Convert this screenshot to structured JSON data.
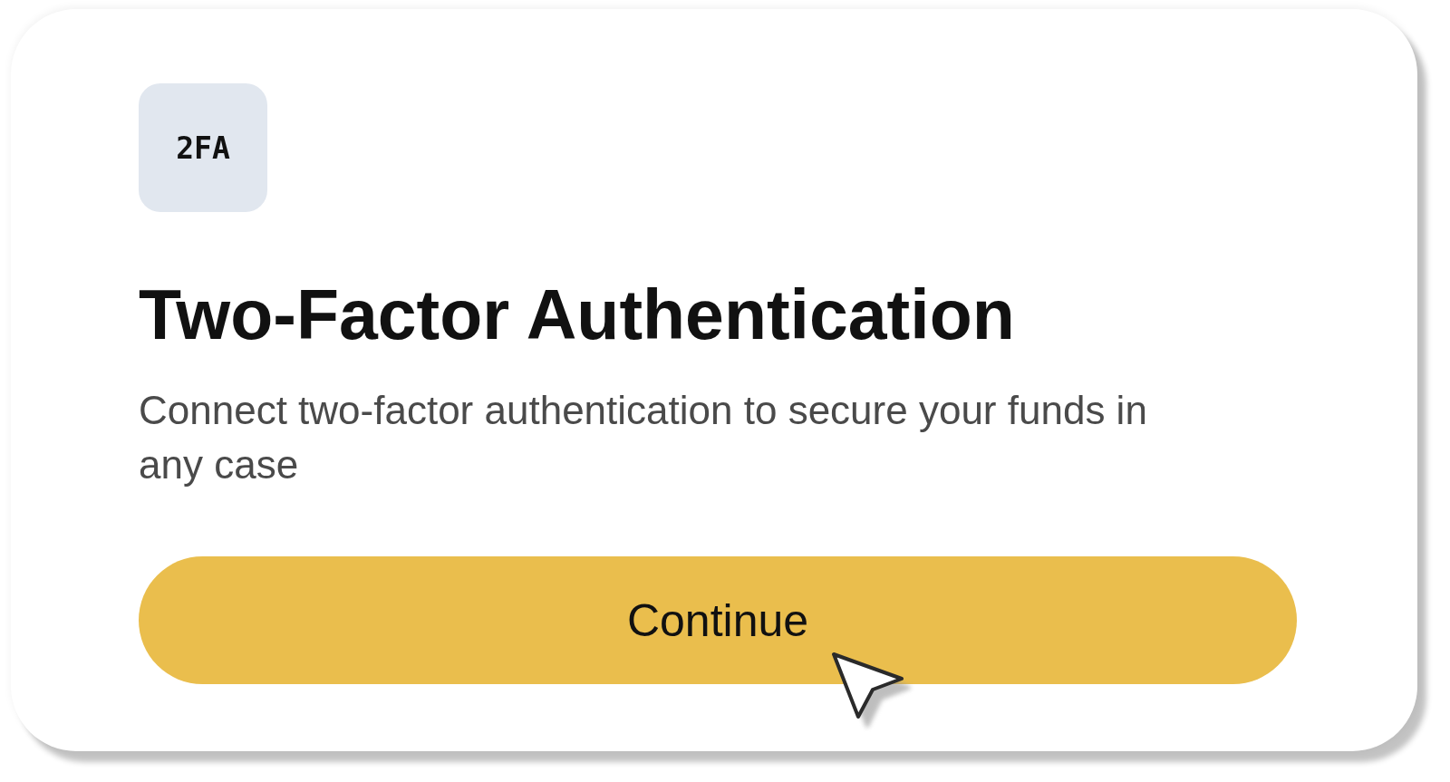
{
  "card": {
    "icon_label": "2FA",
    "title": "Two-Factor Authentication",
    "description": "Connect two-factor authentication to secure your funds in any case",
    "button": {
      "label": "Continue"
    }
  }
}
